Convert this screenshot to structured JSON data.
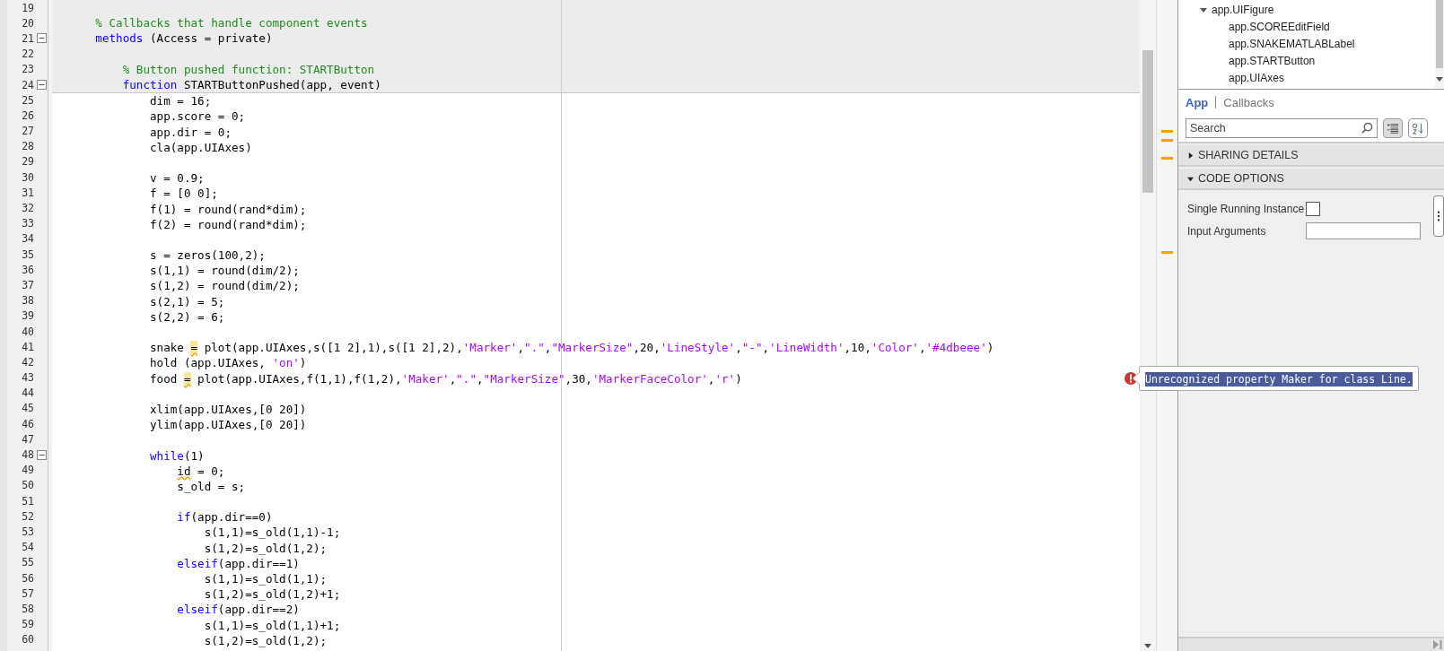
{
  "editor": {
    "blocks": [
      {
        "kind": "read-only",
        "lines": [
          {
            "number": "19",
            "fold": false
          },
          {
            "number": "20",
            "fold": false,
            "segments": [
              {
                "kind": "comment",
                "text": "    % Callbacks that handle component events"
              }
            ]
          },
          {
            "number": "21",
            "fold": true,
            "segments": [
              {
                "kind": "keyword",
                "text": "    methods"
              },
              {
                "kind": "code",
                "text": " (Access = private)"
              }
            ]
          },
          {
            "number": "22",
            "fold": false
          },
          {
            "number": "23",
            "fold": false,
            "segments": [
              {
                "kind": "comment",
                "text": "        % Button pushed function: STARTButton"
              }
            ]
          },
          {
            "number": "24",
            "fold": true,
            "segments": [
              {
                "kind": "keyword",
                "text": "        function"
              },
              {
                "kind": "code",
                "text": " STARTButtonPushed(app, event)"
              }
            ]
          }
        ]
      },
      {
        "kind": "editable",
        "lines": [
          {
            "number": "25",
            "fold": false,
            "segments": [
              {
                "kind": "code",
                "text": "            dim = 16;"
              }
            ]
          },
          {
            "number": "26",
            "fold": false,
            "segments": [
              {
                "kind": "code",
                "text": "            app.score = 0;"
              }
            ]
          },
          {
            "number": "27",
            "fold": false,
            "segments": [
              {
                "kind": "code",
                "text": "            app.dir = 0;"
              }
            ]
          },
          {
            "number": "28",
            "fold": false,
            "segments": [
              {
                "kind": "code",
                "text": "            cla(app.UIAxes)"
              }
            ]
          },
          {
            "number": "29",
            "fold": false
          },
          {
            "number": "30",
            "fold": false,
            "segments": [
              {
                "kind": "code",
                "text": "            v = 0.9;"
              }
            ]
          },
          {
            "number": "31",
            "fold": false,
            "segments": [
              {
                "kind": "code",
                "text": "            f = [0 0];"
              }
            ]
          },
          {
            "number": "32",
            "fold": false,
            "segments": [
              {
                "kind": "code",
                "text": "            f(1) = round(rand*dim);"
              }
            ]
          },
          {
            "number": "33",
            "fold": false,
            "segments": [
              {
                "kind": "code",
                "text": "            f(2) = round(rand*dim);"
              }
            ]
          },
          {
            "number": "34",
            "fold": false
          },
          {
            "number": "35",
            "fold": false,
            "segments": [
              {
                "kind": "code",
                "text": "            s = zeros(100,2);"
              }
            ]
          },
          {
            "number": "36",
            "fold": false,
            "segments": [
              {
                "kind": "code",
                "text": "            s(1,1) = round(dim/2);"
              }
            ]
          },
          {
            "number": "37",
            "fold": false,
            "segments": [
              {
                "kind": "code",
                "text": "            s(1,2) = round(dim/2);"
              }
            ]
          },
          {
            "number": "38",
            "fold": false,
            "segments": [
              {
                "kind": "code",
                "text": "            s(2,1) = 5;"
              }
            ]
          },
          {
            "number": "39",
            "fold": false,
            "segments": [
              {
                "kind": "code",
                "text": "            s(2,2) = 6;"
              }
            ]
          },
          {
            "number": "40",
            "fold": false
          },
          {
            "number": "41",
            "fold": false,
            "segments": [
              {
                "kind": "code",
                "text": "            snake "
              },
              {
                "kind": "warning",
                "text": "="
              },
              {
                "kind": "code",
                "text": " plot(app.UIAxes,s([1 2],1),s([1 2],2),"
              },
              {
                "kind": "string",
                "text": "'Marker'"
              },
              {
                "kind": "code",
                "text": ","
              },
              {
                "kind": "string",
                "text": "\".\""
              },
              {
                "kind": "code",
                "text": ","
              },
              {
                "kind": "string",
                "text": "\"MarkerSize\""
              },
              {
                "kind": "code",
                "text": ",20,"
              },
              {
                "kind": "string",
                "text": "'LineStyle'"
              },
              {
                "kind": "code",
                "text": ","
              },
              {
                "kind": "string",
                "text": "\"-\""
              },
              {
                "kind": "code",
                "text": ","
              },
              {
                "kind": "string",
                "text": "'LineWidth'"
              },
              {
                "kind": "code",
                "text": ",10,"
              },
              {
                "kind": "string",
                "text": "'Color'"
              },
              {
                "kind": "code",
                "text": ","
              },
              {
                "kind": "string",
                "text": "'#4dbeee'"
              },
              {
                "kind": "code",
                "text": ")"
              }
            ]
          },
          {
            "number": "42",
            "fold": false,
            "segments": [
              {
                "kind": "code",
                "text": "            hold (app.UIAxes, "
              },
              {
                "kind": "string",
                "text": "'on'"
              },
              {
                "kind": "code",
                "text": ")"
              }
            ]
          },
          {
            "number": "43",
            "fold": false,
            "error_message": "Unrecognized property Maker for class Line.",
            "segments": [
              {
                "kind": "code",
                "text": "            food "
              },
              {
                "kind": "warning",
                "text": "="
              },
              {
                "kind": "code",
                "text": " plot(app.UIAxes,f(1,1),f(1,2),"
              },
              {
                "kind": "string",
                "text": "'Maker'"
              },
              {
                "kind": "code",
                "text": ","
              },
              {
                "kind": "string",
                "text": "\".\""
              },
              {
                "kind": "code",
                "text": ","
              },
              {
                "kind": "string",
                "text": "\"MarkerSize\""
              },
              {
                "kind": "code",
                "text": ",30,"
              },
              {
                "kind": "string",
                "text": "'MarkerFaceColor'"
              },
              {
                "kind": "code",
                "text": ","
              },
              {
                "kind": "string",
                "text": "'r'"
              },
              {
                "kind": "code",
                "text": ")"
              }
            ]
          },
          {
            "number": "44",
            "fold": false
          },
          {
            "number": "45",
            "fold": false,
            "segments": [
              {
                "kind": "code",
                "text": "            xlim(app.UIAxes,[0 20])"
              }
            ]
          },
          {
            "number": "46",
            "fold": false,
            "segments": [
              {
                "kind": "code",
                "text": "            ylim(app.UIAxes,[0 20])"
              }
            ]
          },
          {
            "number": "47",
            "fold": false
          },
          {
            "number": "48",
            "fold": true,
            "segments": [
              {
                "kind": "keyword",
                "text": "            while"
              },
              {
                "kind": "code",
                "text": "(1)"
              }
            ]
          },
          {
            "number": "49",
            "fold": false,
            "segments": [
              {
                "kind": "lint",
                "text": "                id"
              },
              {
                "kind": "code",
                "text": " = 0;"
              }
            ]
          },
          {
            "number": "50",
            "fold": false,
            "segments": [
              {
                "kind": "code",
                "text": "                s_old = s;"
              }
            ]
          },
          {
            "number": "51",
            "fold": false
          },
          {
            "number": "52",
            "fold": false,
            "segments": [
              {
                "kind": "keyword",
                "text": "                if"
              },
              {
                "kind": "code",
                "text": "(app.dir==0)"
              }
            ]
          },
          {
            "number": "53",
            "fold": false,
            "segments": [
              {
                "kind": "code",
                "text": "                    s(1,1)=s_old(1,1)-1;"
              }
            ]
          },
          {
            "number": "54",
            "fold": false,
            "segments": [
              {
                "kind": "code",
                "text": "                    s(1,2)=s_old(1,2);"
              }
            ]
          },
          {
            "number": "55",
            "fold": false,
            "segments": [
              {
                "kind": "keyword",
                "text": "                elseif"
              },
              {
                "kind": "code",
                "text": "(app.dir==1)"
              }
            ]
          },
          {
            "number": "56",
            "fold": false,
            "segments": [
              {
                "kind": "code",
                "text": "                    s(1,1)=s_old(1,1);"
              }
            ]
          },
          {
            "number": "57",
            "fold": false,
            "segments": [
              {
                "kind": "code",
                "text": "                    s(1,2)=s_old(1,2)+1;"
              }
            ]
          },
          {
            "number": "58",
            "fold": false,
            "segments": [
              {
                "kind": "keyword",
                "text": "                elseif"
              },
              {
                "kind": "code",
                "text": "(app.dir==2)"
              }
            ]
          },
          {
            "number": "59",
            "fold": false,
            "segments": [
              {
                "kind": "code",
                "text": "                    s(1,1)=s_old(1,1)+1;"
              }
            ]
          },
          {
            "number": "60",
            "fold": false,
            "segments": [
              {
                "kind": "code",
                "text": "                    s(1,2)=s_old(1,2);"
              }
            ]
          }
        ]
      }
    ]
  },
  "component_browser": {
    "items": [
      {
        "label": "app.UIFigure",
        "expanded": true,
        "children": [
          {
            "label": "app.SCOREEditField"
          },
          {
            "label": "app.SNAKEMATLABLabel"
          },
          {
            "label": "app.STARTButton"
          },
          {
            "label": "app.UIAxes"
          }
        ]
      }
    ]
  },
  "inspector": {
    "tabs": [
      {
        "label": "App",
        "selected": true
      },
      {
        "label": "Callbacks",
        "selected": false
      }
    ],
    "search": {
      "placeholder": "Search"
    },
    "sections": [
      {
        "title": "SHARING DETAILS",
        "expanded": false
      },
      {
        "title": "CODE OPTIONS",
        "expanded": true,
        "properties": [
          {
            "kind": "checkbox",
            "label": "Single Running Instance",
            "checked": false
          },
          {
            "kind": "text",
            "label": "Input Arguments"
          }
        ]
      }
    ]
  }
}
